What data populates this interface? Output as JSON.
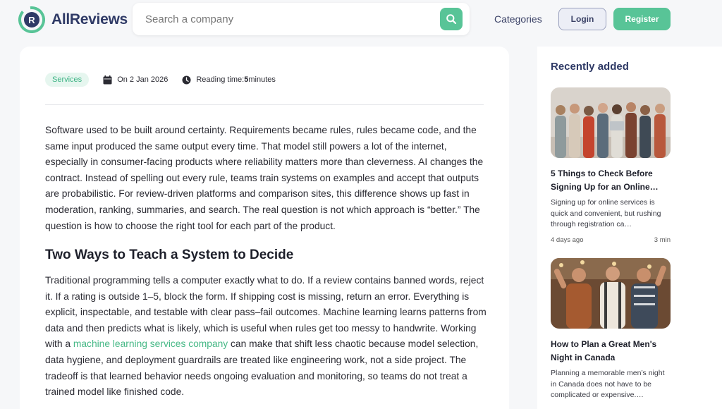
{
  "header": {
    "brand": "AllReviews",
    "search_placeholder": "Search a company",
    "nav_categories": "Categories",
    "login_label": "Login",
    "register_label": "Register"
  },
  "colors": {
    "brand_navy": "#2f3a66",
    "accent_green": "#58c497",
    "link_green": "#46b886"
  },
  "article": {
    "tag": "Services",
    "date": "On 2 Jan 2026",
    "reading_label": "Reading time: ",
    "reading_value": "5",
    "reading_unit": " minutes",
    "intro": "Software used to be built around certainty. Requirements became rules, rules became code, and the same input produced the same output every time. That model still powers a lot of the internet, especially in consumer-facing products where reliability matters more than cleverness. AI changes the contract. Instead of spelling out every rule, teams train systems on examples and accept that outputs are probabilistic. For review-driven platforms and comparison sites, this difference shows up fast in moderation, ranking, summaries, and search. The real question is not which approach is “better.” The question is how to choose the right tool for each part of the product.",
    "heading": "Two Ways to Teach a System to Decide",
    "body_before_link": "Traditional programming tells a computer exactly what to do. If a review contains banned words, reject it. If a rating is outside 1–5, block the form. If shipping cost is missing, return an error. Everything is explicit, inspectable, and testable with clear pass–fail outcomes. Machine learning learns patterns from data and then predicts what is likely, which is useful when rules get too messy to handwrite. Working with a ",
    "link_text": "machine learning services company",
    "body_after_link": " can make that shift less chaotic because model selection, data hygiene, and deployment guardrails are treated like engineering work, not a side project. The tradeoff is that learned behavior needs ongoing evaluation and monitoring, so teams do not treat a trained model like finished code."
  },
  "sidebar": {
    "title": "Recently added",
    "cards": [
      {
        "title_line1": "5 Things to Check Before",
        "title_line2": "Signing Up for an Online…",
        "excerpt": "Signing up for online services is quick and convenient, but rushing through registration ca…",
        "date": "4 days ago",
        "read": "3 min",
        "image": "group-of-people-with-phones-photo"
      },
      {
        "title_line1": "How to Plan a Great Men's",
        "title_line2": "Night in Canada",
        "excerpt": "Planning a memorable men’s night in Canada does not have to be complicated or expensive.…",
        "image": "men-cheering-in-bar-photo"
      }
    ]
  }
}
